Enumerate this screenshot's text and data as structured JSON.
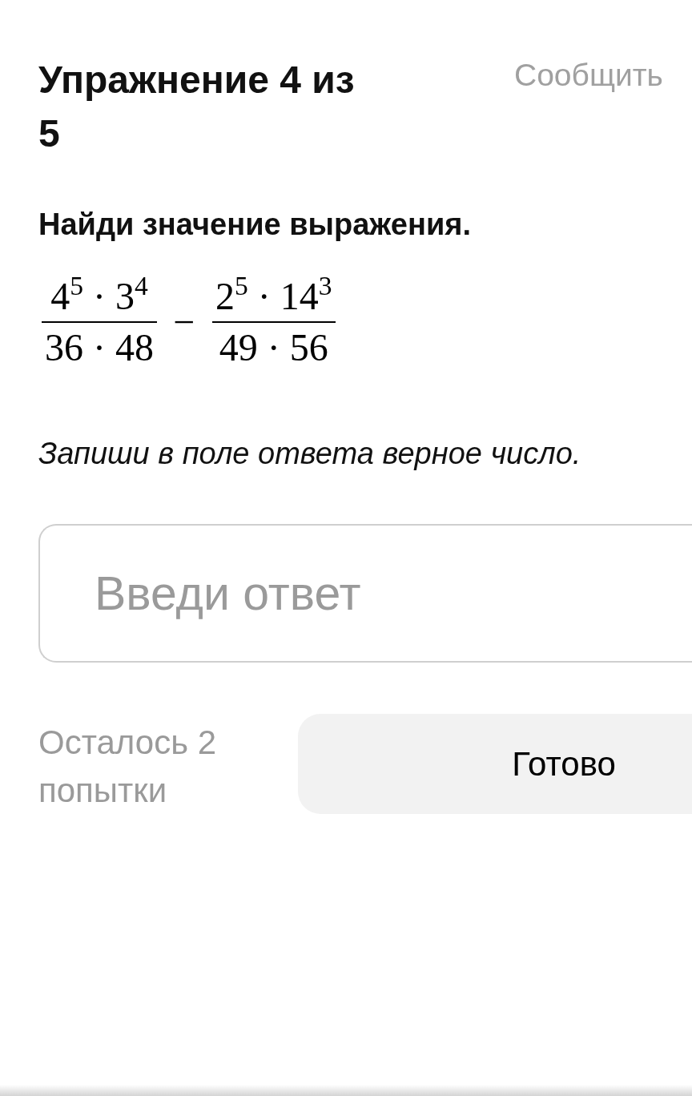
{
  "header": {
    "title": "Упражнение 4 из 5",
    "report_link": "Сообщить"
  },
  "task": {
    "instruction": "Найди значение выражения.",
    "expression": [
      {
        "kind": "fraction",
        "numerator": "4$^{5}$ · 3$^{4}$",
        "denominator": "36 · 48"
      },
      {
        "kind": "operator",
        "symbol": "−"
      },
      {
        "kind": "fraction",
        "numerator": "2$^{5}$ · 14$^{3}$",
        "denominator": "49 · 56"
      }
    ],
    "hint": "Запиши в поле ответа верное число."
  },
  "answer": {
    "placeholder": "Введи ответ"
  },
  "footer": {
    "attempts": "Осталось 2 попытки",
    "submit_button": "Готово"
  }
}
